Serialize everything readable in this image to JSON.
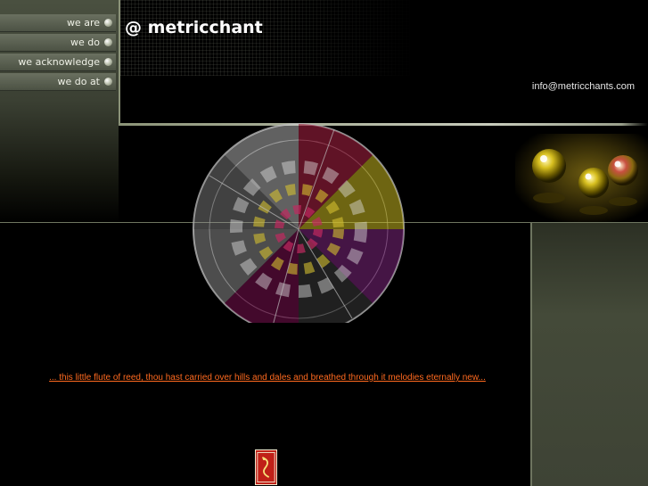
{
  "nav": {
    "items": [
      {
        "label": "we are"
      },
      {
        "label": "we do"
      },
      {
        "label": "we acknowledge"
      },
      {
        "label": "we do at"
      }
    ]
  },
  "header": {
    "title": "@ metricchant",
    "email": "info@metricchants.com"
  },
  "main": {
    "tagline": "... this little flute of reed, thou hast carried over hills and dales and breathed through it melodies eternally new..."
  },
  "colors": {
    "accent_olive": "#4a5040",
    "link_orange": "#ff6a1f",
    "background": "#000000"
  }
}
